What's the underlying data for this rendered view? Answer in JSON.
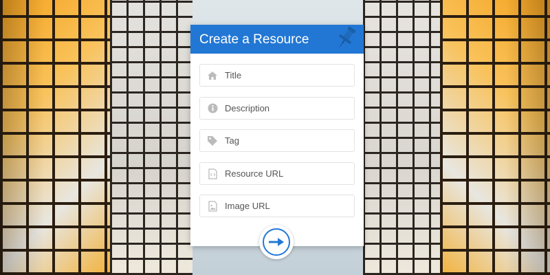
{
  "form": {
    "title": "Create a Resource",
    "fields": [
      {
        "placeholder": "Title",
        "icon": "home-icon"
      },
      {
        "placeholder": "Description",
        "icon": "info-icon"
      },
      {
        "placeholder": "Tag",
        "icon": "tag-icon"
      },
      {
        "placeholder": "Resource URL",
        "icon": "code-file-icon"
      },
      {
        "placeholder": "Image URL",
        "icon": "image-file-icon"
      }
    ],
    "submit_icon": "arrow-right-icon"
  },
  "colors": {
    "accent": "#2277d4",
    "icon_gray": "#bbbbbb",
    "header_text": "#ffffff"
  }
}
